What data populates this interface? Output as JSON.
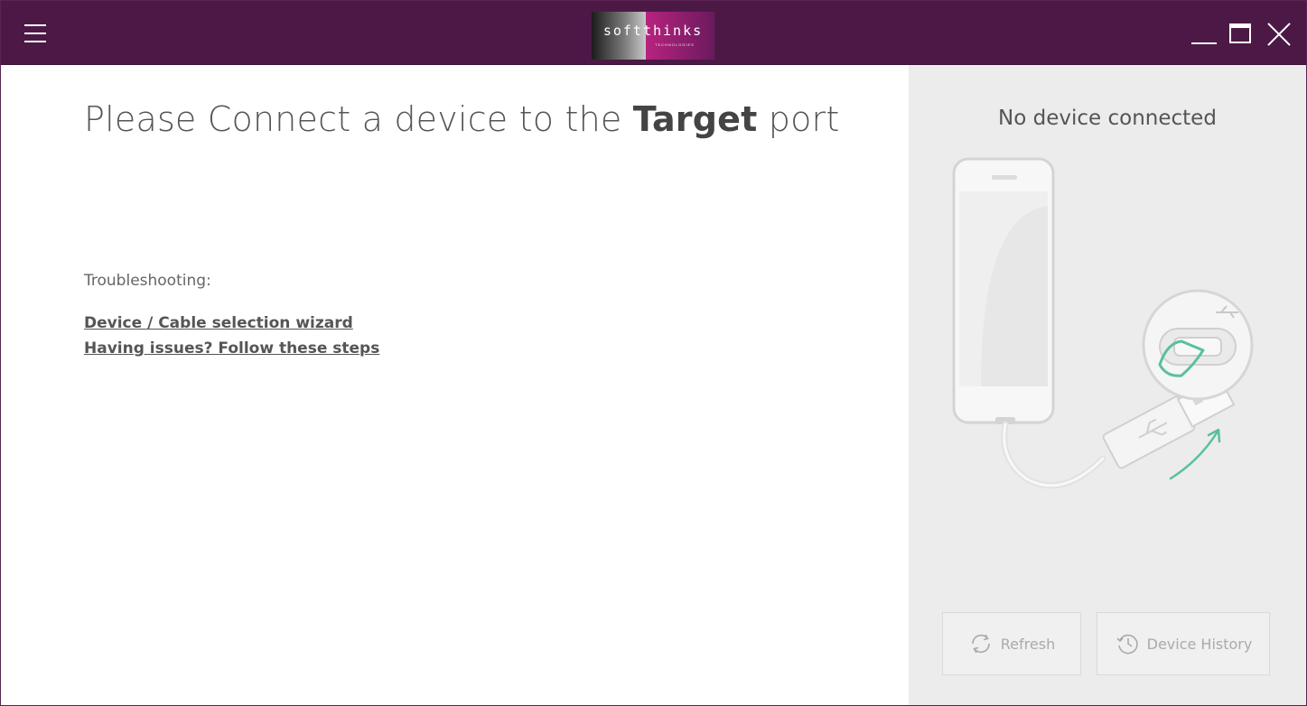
{
  "titlebar": {
    "logo_text": "softthinks",
    "logo_subtext": "TECHNOLOGIES",
    "menu_icon": "hamburger-icon",
    "minimize_icon": "minimize-icon",
    "maximize_icon": "maximize-icon",
    "close_icon": "close-icon"
  },
  "main": {
    "heading_prefix": "Please Connect a device to the ",
    "heading_bold": "Target",
    "heading_suffix": " port",
    "troubleshooting_label": "Troubleshooting:",
    "links": [
      "Device / Cable selection wizard",
      "Having issues? Follow these steps"
    ]
  },
  "side": {
    "status": "No device connected",
    "illustration": "phone-usb-connect-illustration",
    "buttons": {
      "refresh_label": "Refresh",
      "refresh_icon": "refresh-icon",
      "history_label": "Device History",
      "history_icon": "history-icon"
    }
  },
  "colors": {
    "titlebar": "#4c1946",
    "accent_green": "#5bbf9f",
    "side_panel": "#ececec"
  }
}
